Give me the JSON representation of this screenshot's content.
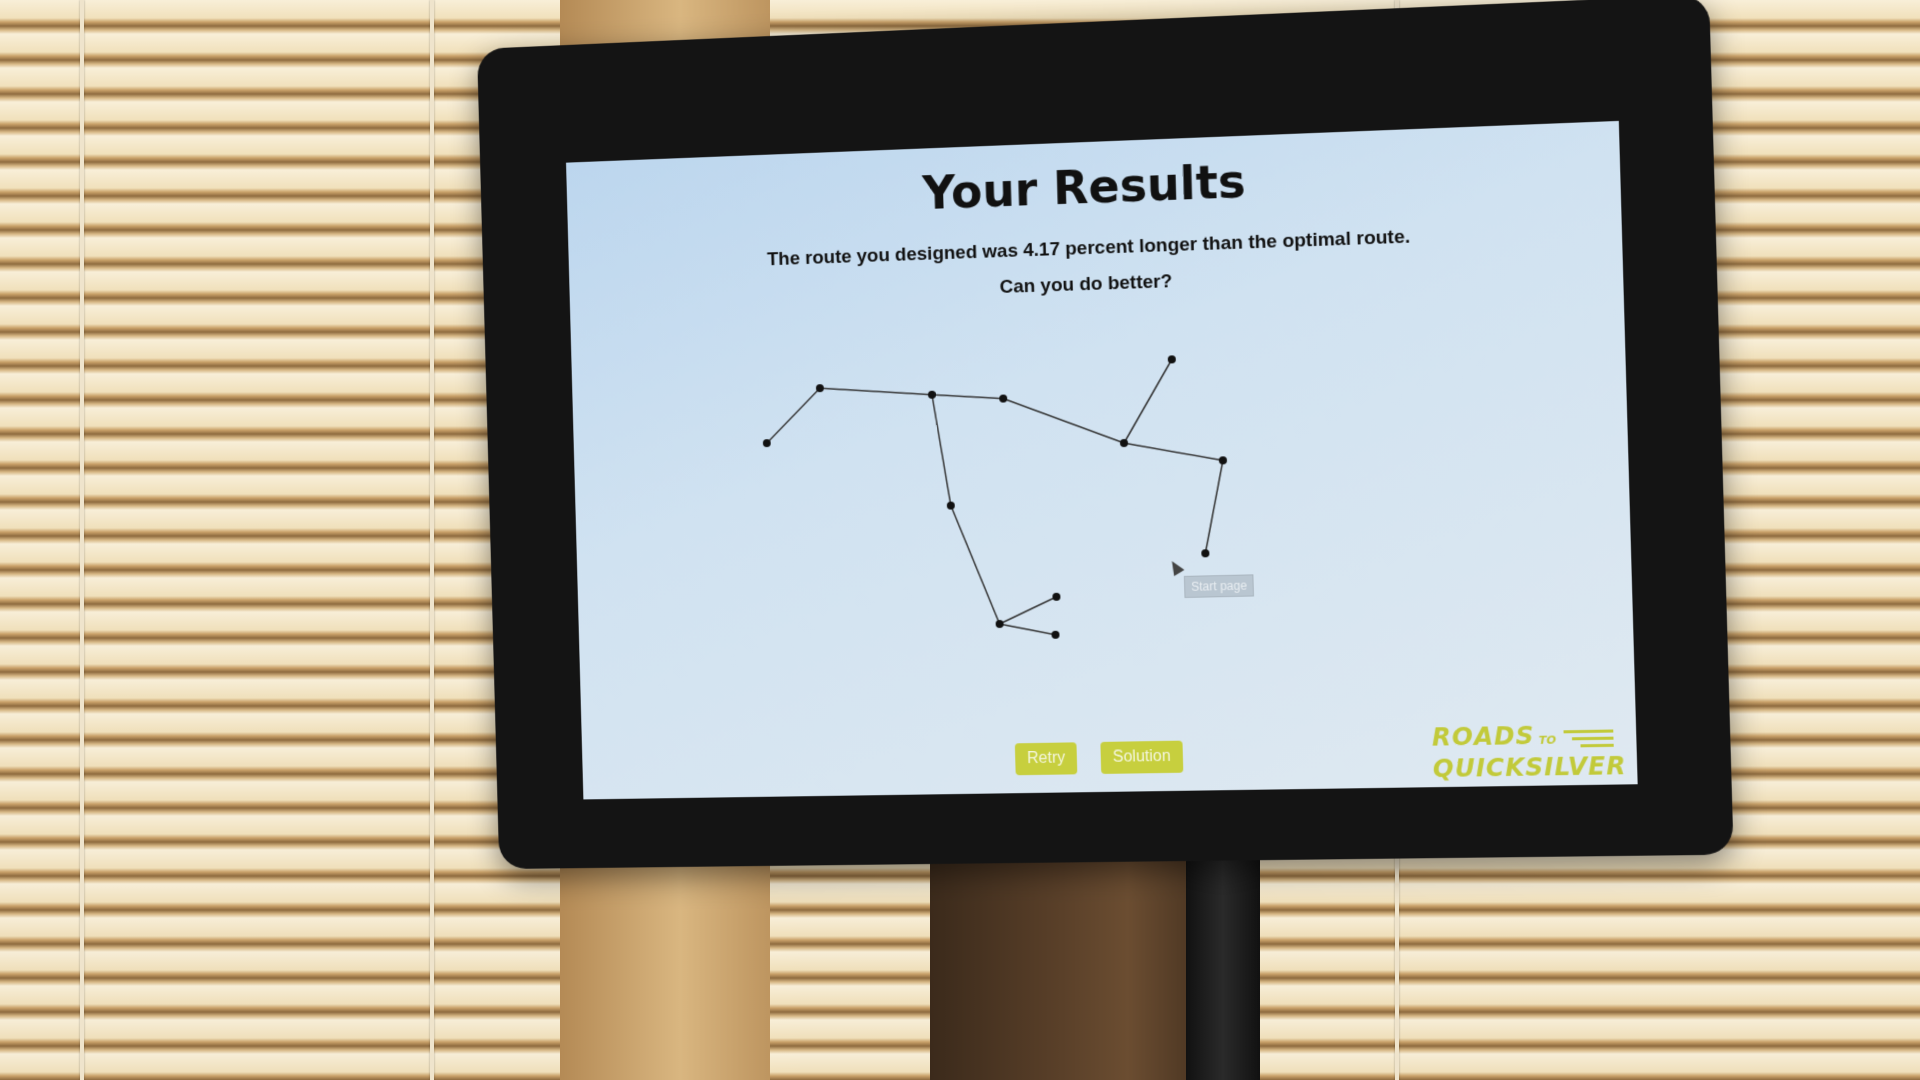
{
  "screen": {
    "title": "Your Results",
    "result_text": "The route you designed was 4.17 percent longer than the optimal route.",
    "prompt_text": "Can you do better?",
    "tooltip": "Start page",
    "buttons": {
      "retry_label": "Retry",
      "solution_label": "Solution"
    },
    "logo": {
      "word1": "ROADS",
      "word_to": "TO",
      "word2": "QUICKSILVER"
    }
  },
  "colors": {
    "accent": "#c7cf3e",
    "screen_bg": "#cfe1f1",
    "text": "#111111"
  },
  "icons": [
    "mouse-pointer-icon",
    "speed-lines-icon"
  ]
}
